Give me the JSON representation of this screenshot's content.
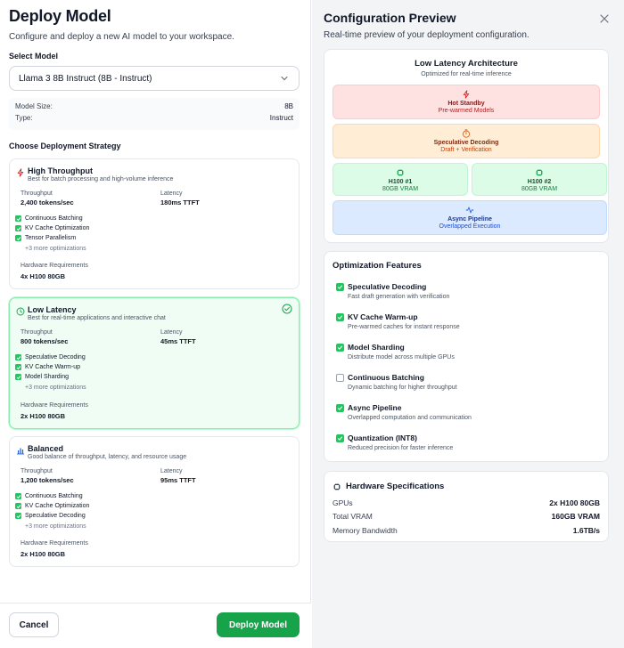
{
  "left": {
    "title": "Deploy Model",
    "subtitle": "Configure and deploy a new AI model to your workspace.",
    "select_model_label": "Select Model",
    "selected_model": "Llama 3 8B Instruct (8B - Instruct)",
    "model_info": {
      "size_label": "Model Size:",
      "size_value": "8B",
      "type_label": "Type:",
      "type_value": "Instruct"
    },
    "strategy_label": "Choose Deployment Strategy",
    "strategies": [
      {
        "name": "High Throughput",
        "description": "Best for batch processing and high-volume inference",
        "icon": "lightning-icon",
        "throughput_label": "Throughput",
        "throughput_value": "2,400 tokens/sec",
        "latency_label": "Latency",
        "latency_value": "180ms TTFT",
        "features": [
          "Continuous Batching",
          "KV Cache Optimization",
          "Tensor Parallelism"
        ],
        "more": "+3 more optimizations",
        "hw_label": "Hardware Requirements",
        "hw_value": "4x H100 80GB",
        "selected": false
      },
      {
        "name": "Low Latency",
        "description": "Best for real-time applications and interactive chat",
        "icon": "clock-icon",
        "throughput_label": "Throughput",
        "throughput_value": "800 tokens/sec",
        "latency_label": "Latency",
        "latency_value": "45ms TTFT",
        "features": [
          "Speculative Decoding",
          "KV Cache Warm-up",
          "Model Sharding"
        ],
        "more": "+3 more optimizations",
        "hw_label": "Hardware Requirements",
        "hw_value": "2x H100 80GB",
        "selected": true
      },
      {
        "name": "Balanced",
        "description": "Good balance of throughput, latency, and resource usage",
        "icon": "bar-chart-icon",
        "throughput_label": "Throughput",
        "throughput_value": "1,200 tokens/sec",
        "latency_label": "Latency",
        "latency_value": "95ms TTFT",
        "features": [
          "Continuous Batching",
          "KV Cache Optimization",
          "Speculative Decoding"
        ],
        "more": "+3 more optimizations",
        "hw_label": "Hardware Requirements",
        "hw_value": "2x H100 80GB",
        "selected": false
      }
    ],
    "cancel_label": "Cancel",
    "deploy_label": "Deploy Model"
  },
  "right": {
    "title": "Configuration Preview",
    "subtitle": "Real-time preview of your deployment configuration.",
    "architecture": {
      "title": "Low Latency Architecture",
      "subtitle": "Optimized for real-time inference",
      "blocks": {
        "standby_title": "Hot Standby",
        "standby_sub": "Pre-warmed Models",
        "spec_title": "Speculative Decoding",
        "spec_sub": "Draft + Verification",
        "gpu1_title": "H100 #1",
        "gpu1_sub": "80GB VRAM",
        "gpu2_title": "H100 #2",
        "gpu2_sub": "80GB VRAM",
        "async_title": "Async Pipeline",
        "async_sub": "Overlapped Execution"
      }
    },
    "optimization": {
      "title": "Optimization Features",
      "items": [
        {
          "name": "Speculative Decoding",
          "desc": "Fast draft generation with verification",
          "checked": true
        },
        {
          "name": "KV Cache Warm-up",
          "desc": "Pre-warmed caches for instant response",
          "checked": true
        },
        {
          "name": "Model Sharding",
          "desc": "Distribute model across multiple GPUs",
          "checked": true
        },
        {
          "name": "Continuous Batching",
          "desc": "Dynamic batching for higher throughput",
          "checked": false
        },
        {
          "name": "Async Pipeline",
          "desc": "Overlapped computation and communication",
          "checked": true
        },
        {
          "name": "Quantization (INT8)",
          "desc": "Reduced precision for faster inference",
          "checked": true
        }
      ]
    },
    "hardware": {
      "title": "Hardware Specifications",
      "gpus_label": "GPUs",
      "gpus_value": "2x H100 80GB",
      "vram_label": "Total VRAM",
      "vram_value": "160GB VRAM",
      "bw_label": "Memory Bandwidth",
      "bw_value": "1.6TB/s"
    }
  },
  "colors": {
    "accent_green": "#16a34a",
    "check_green": "#22c55e",
    "selected_bg": "#f0fdf4"
  }
}
